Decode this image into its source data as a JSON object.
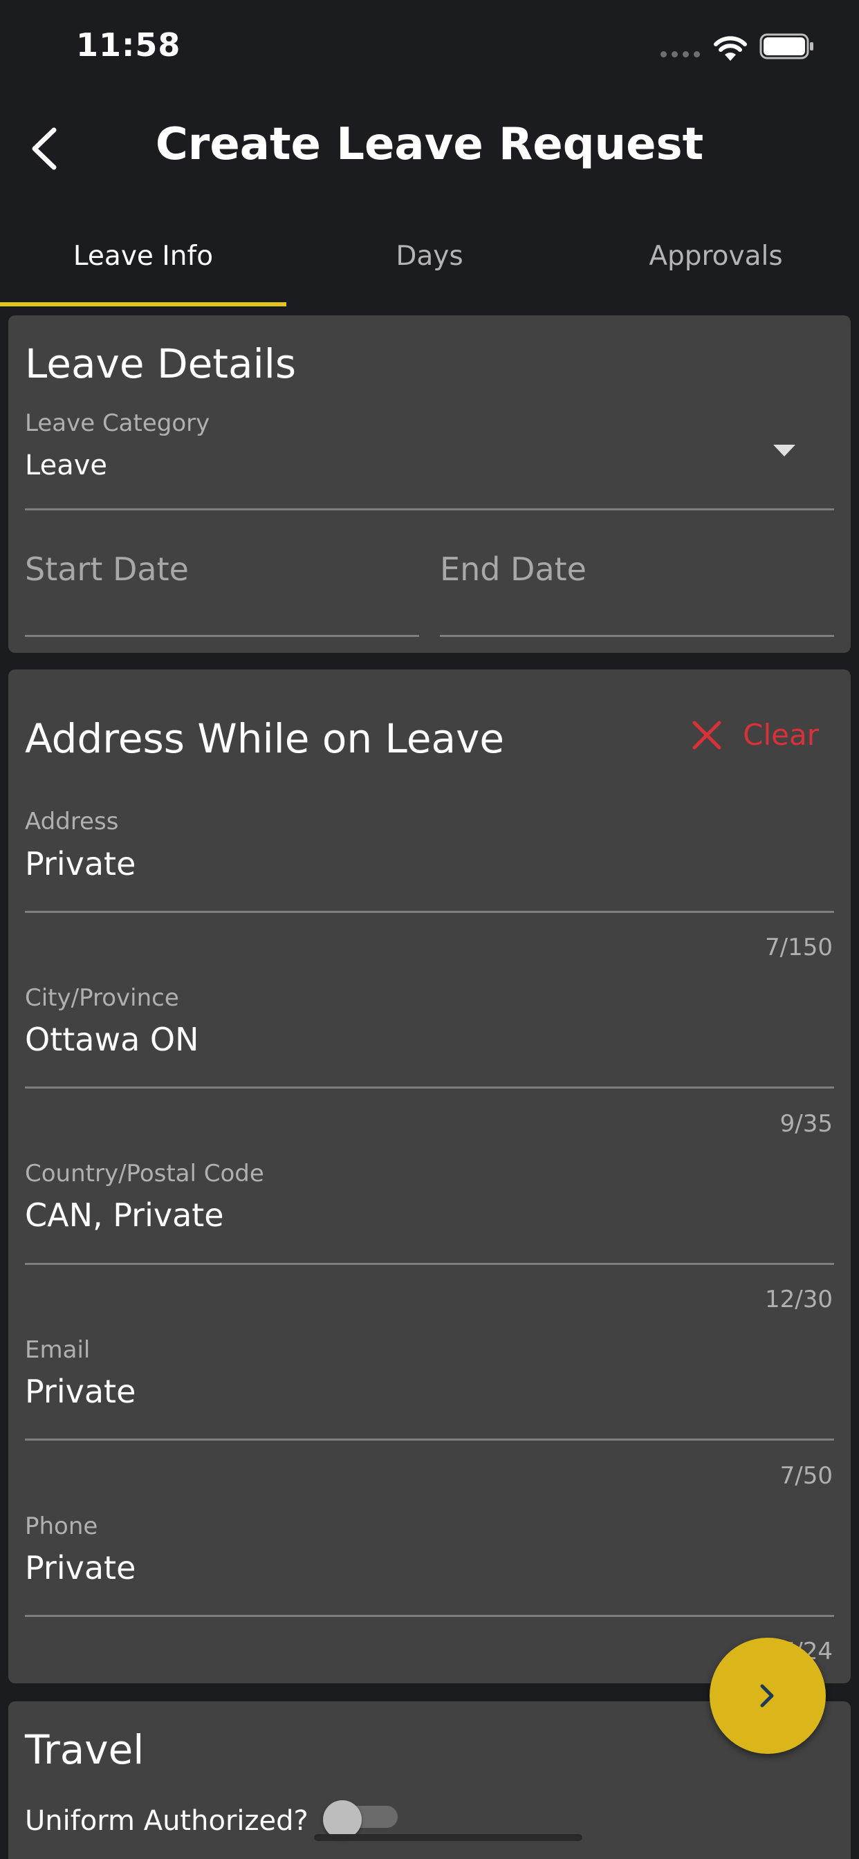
{
  "status_bar": {
    "time": "11:58"
  },
  "header": {
    "title": "Create Leave Request"
  },
  "tabs": [
    {
      "label": "Leave Info",
      "active": true
    },
    {
      "label": "Days",
      "active": false
    },
    {
      "label": "Approvals",
      "active": false
    }
  ],
  "leave_details": {
    "title": "Leave Details",
    "category": {
      "label": "Leave Category",
      "value": "Leave"
    },
    "start_date": {
      "placeholder": "Start Date"
    },
    "end_date": {
      "placeholder": "End Date"
    }
  },
  "address_section": {
    "title": "Address While on Leave",
    "clear_label": "Clear",
    "fields": [
      {
        "label": "Address",
        "value": "Private",
        "counter": "7/150"
      },
      {
        "label": "City/Province",
        "value": "Ottawa ON",
        "counter": "9/35"
      },
      {
        "label": "Country/Postal Code",
        "value": "CAN, Private",
        "counter": "12/30"
      },
      {
        "label": "Email",
        "value": "Private",
        "counter": "7/50"
      },
      {
        "label": "Phone",
        "value": "Private",
        "counter": "7/24"
      }
    ]
  },
  "travel": {
    "title": "Travel",
    "uniform_label": "Uniform Authorized?",
    "uniform_on": false
  },
  "colors": {
    "accent": "#e5c61b",
    "fab": "#dbb61a",
    "clear": "#d8313a",
    "card": "#424242",
    "background": "#1b1c1f"
  }
}
